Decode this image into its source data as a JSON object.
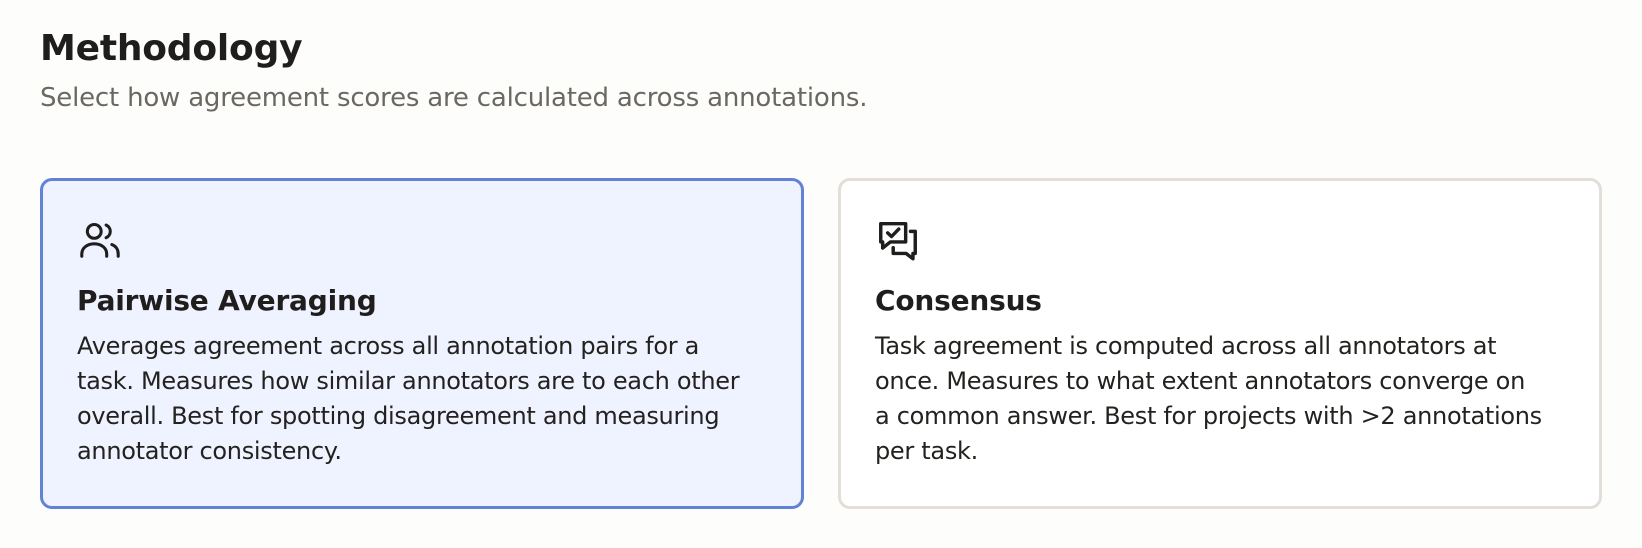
{
  "section": {
    "title": "Methodology",
    "subtitle": "Select how agreement scores are calculated across annotations."
  },
  "options": [
    {
      "icon": "users-icon",
      "title": "Pairwise Averaging",
      "description": "Averages agreement across all annotation pairs for a task. Measures how similar annotators are to each other overall. Best for spotting disagreement and measuring annotator consistency.",
      "selected": true
    },
    {
      "icon": "message-check-icon",
      "title": "Consensus",
      "description": "Task agreement is computed across all annotators at once. Measures to what extent annotators converge on a common answer. Best for projects with >2 annotations per task.",
      "selected": false
    }
  ],
  "colors": {
    "selected_border": "#6282d6",
    "selected_background": "#eff2ff",
    "unselected_border": "#e3ded7",
    "text_primary": "#1f1e1c",
    "text_secondary": "#6b6862"
  }
}
